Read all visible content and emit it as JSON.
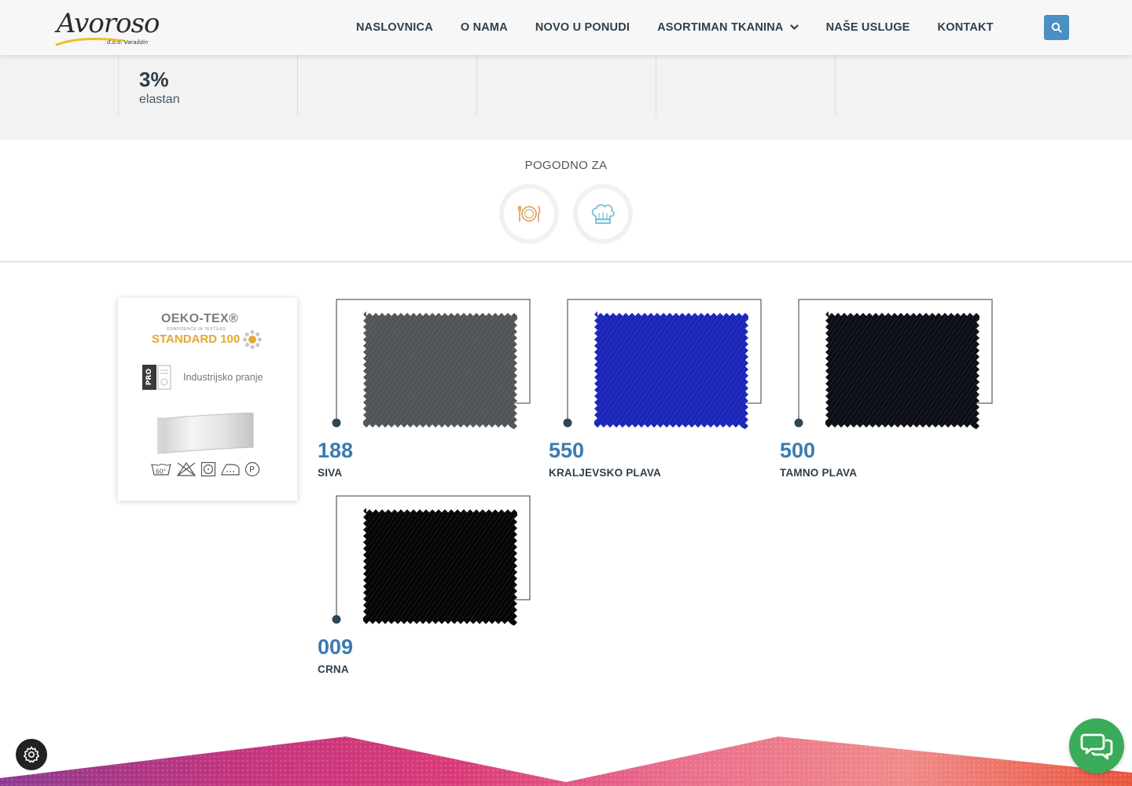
{
  "header": {
    "logo_text": "Avoroso",
    "logo_sub": "d.o.o. Varaždin",
    "nav": [
      {
        "label": "NASLOVNICA"
      },
      {
        "label": "O NAMA"
      },
      {
        "label": "NOVO U PONUDI"
      },
      {
        "label": "ASORTIMAN TKANINA",
        "has_dropdown": true
      },
      {
        "label": "NAŠE USLUGE"
      },
      {
        "label": "KONTAKT"
      }
    ],
    "search_icon": "search-icon",
    "accent_color": "#4a90c2"
  },
  "composition": {
    "items": [
      {
        "percent": "3%",
        "name": "elastan"
      }
    ]
  },
  "suitable": {
    "title": "POGODNO ZA",
    "icons": [
      "restaurant-icon",
      "chef-hat-icon"
    ]
  },
  "certification": {
    "oeko_line1": "OEKO-TEX®",
    "oeko_line2": "CONFIDENCE IN TEXTILES",
    "oeko_line3": "STANDARD 100",
    "pro_badge": "PRO",
    "pro_text": "Industrijsko pranje",
    "care_wash_temp": "60°",
    "care_dry_clean": "P"
  },
  "swatches": [
    {
      "code": "188",
      "name": "SIVA",
      "color": "#505457"
    },
    {
      "code": "550",
      "name": "KRALJEVSKO PLAVA",
      "color": "#1a24b8"
    },
    {
      "code": "500",
      "name": "TAMNO PLAVA",
      "color": "#0b0d14"
    },
    {
      "code": "009",
      "name": "CRNA",
      "color": "#050505"
    }
  ],
  "colors": {
    "code_blue": "#3d7bae",
    "text_dark": "#2f3e4a",
    "chat_green": "#3aab58"
  }
}
